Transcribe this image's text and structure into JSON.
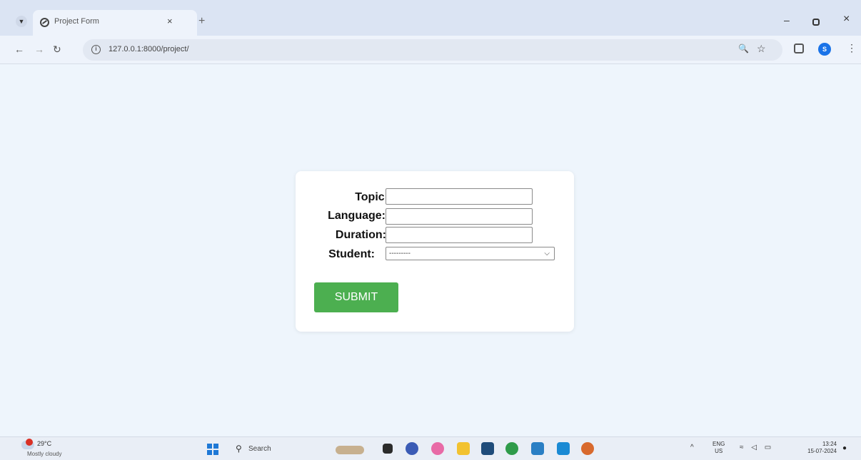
{
  "browser": {
    "tab": {
      "title": "Project Form",
      "close_glyph": "×"
    },
    "new_tab_glyph": "+",
    "window_controls": {
      "minimize": "–",
      "close": "×"
    },
    "nav": {
      "back": "←",
      "forward": "→",
      "reload": "↻"
    },
    "url": "127.0.0.1:8000/project/",
    "toolbar_icons": [
      "zoom-icon",
      "star-icon",
      "extensions-icon",
      "profile-icon",
      "menu-icon"
    ],
    "profile_initial": "S"
  },
  "form": {
    "labels": {
      "topic": "Topic:",
      "language": "Language:",
      "duration": "Duration:",
      "student": "Student:"
    },
    "values": {
      "topic": "",
      "language": "",
      "duration": ""
    },
    "student_selected": "---------",
    "submit_label": "SUBMIT"
  },
  "taskbar": {
    "weather": {
      "temp": "29°C",
      "desc": "Mostly cloudy"
    },
    "search_label": "Search",
    "apps": [
      "explorer-icon",
      "media-icon",
      "chat-icon",
      "copilot-icon",
      "files-icon",
      "store-icon",
      "chrome-icon",
      "mail-icon",
      "vscode-icon",
      "edge-icon"
    ],
    "tray": {
      "lang_top": "ENG",
      "lang_bottom": "US",
      "time": "13:24",
      "date": "15-07-2024"
    }
  },
  "colors": {
    "page_bg": "#eef5fc",
    "submit_bg": "#4caf50",
    "card_bg": "#ffffff"
  }
}
